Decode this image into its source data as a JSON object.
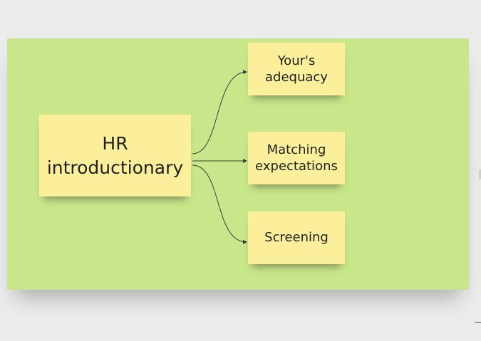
{
  "diagram": {
    "central_note": {
      "text": "HR\nintroductionary"
    },
    "branches": [
      {
        "text": "Your's\nadequacy"
      },
      {
        "text": "Matching\nexpectations"
      },
      {
        "text": "Screening"
      }
    ]
  },
  "colors": {
    "board": "#c9e68a",
    "sticky": "#fcef9c",
    "connector": "#3c3c3c",
    "background": "#ececec"
  }
}
